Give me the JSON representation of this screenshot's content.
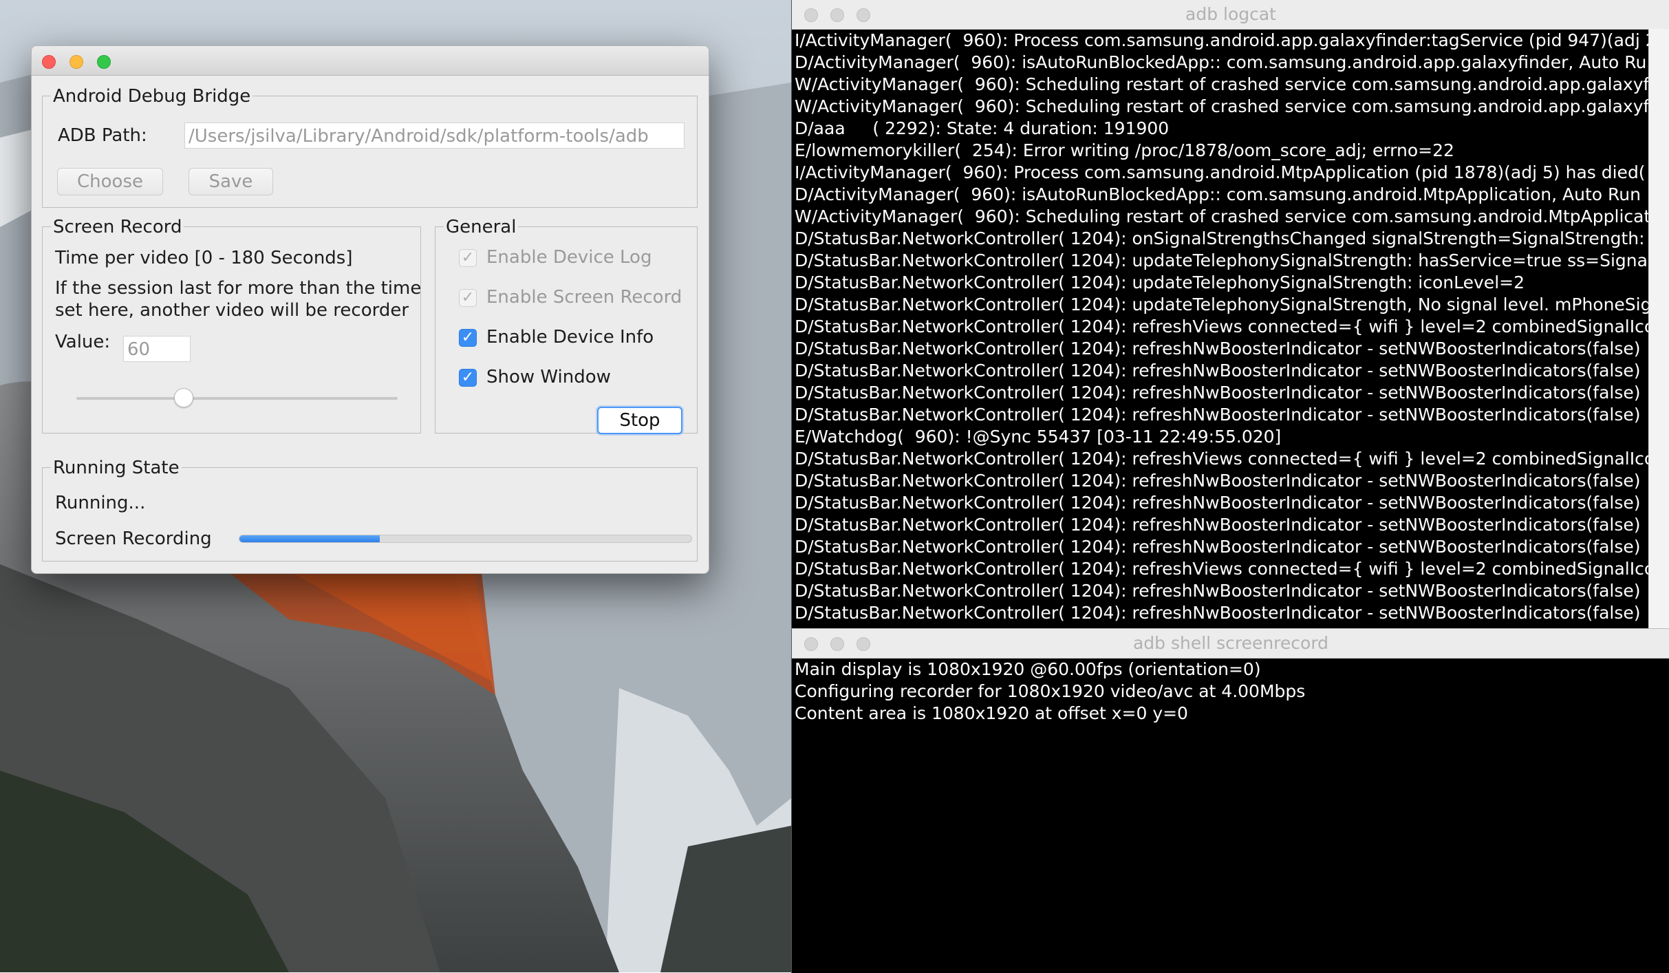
{
  "main_window": {
    "adb_group": {
      "legend": "Android Debug Bridge",
      "path_label": "ADB Path:",
      "path_value": "/Users/jsilva/Library/Android/sdk/platform-tools/adb",
      "choose_label": "Choose",
      "save_label": "Save"
    },
    "screen_record": {
      "legend": "Screen Record",
      "time_label": "Time per video [0 - 180 Seconds]",
      "desc_line1": "If the session last for more than the time",
      "desc_line2": "set here, another video will be recorder",
      "value_label": "Value:",
      "value": "60",
      "slider_min": 0,
      "slider_max": 180,
      "slider_value": 60
    },
    "general": {
      "legend": "General",
      "options": [
        {
          "label": "Enable Device Log",
          "checked": true,
          "enabled": false
        },
        {
          "label": "Enable Screen Record",
          "checked": true,
          "enabled": false
        },
        {
          "label": "Enable Device Info",
          "checked": true,
          "enabled": true
        },
        {
          "label": "Show Window",
          "checked": true,
          "enabled": true
        }
      ],
      "stop_label": "Stop"
    },
    "running_state": {
      "legend": "Running State",
      "status": "Running...",
      "task_label": "Screen Recording",
      "progress": 0.31
    }
  },
  "logcat_window": {
    "title": "adb logcat",
    "lines": [
      "I/ActivityManager(  960): Process com.samsung.android.app.galaxyfinder:tagService (pid 947)(adj 2",
      "D/ActivityManager(  960): isAutoRunBlockedApp:: com.samsung.android.app.galaxyfinder, Auto Ru",
      "W/ActivityManager(  960): Scheduling restart of crashed service com.samsung.android.app.galaxyf",
      "W/ActivityManager(  960): Scheduling restart of crashed service com.samsung.android.app.galaxyf",
      "D/aaa     ( 2292): State: 4 duration: 191900",
      "E/lowmemorykiller(  254): Error writing /proc/1878/oom_score_adj; errno=22",
      "I/ActivityManager(  960): Process com.samsung.android.MtpApplication (pid 1878)(adj 5) has died(",
      "D/ActivityManager(  960): isAutoRunBlockedApp:: com.samsung.android.MtpApplication, Auto Run",
      "W/ActivityManager(  960): Scheduling restart of crashed service com.samsung.android.MtpApplicat",
      "D/StatusBar.NetworkController( 1204): onSignalStrengthsChanged signalStrength=SignalStrength:",
      "D/StatusBar.NetworkController( 1204): updateTelephonySignalStrength: hasService=true ss=Signal",
      "D/StatusBar.NetworkController( 1204): updateTelephonySignalStrength: iconLevel=2",
      "D/StatusBar.NetworkController( 1204): updateTelephonySignalStrength, No signal level. mPhoneSig",
      "D/StatusBar.NetworkController( 1204): refreshViews connected={ wifi } level=2 combinedSignalIco",
      "D/StatusBar.NetworkController( 1204): refreshNwBoosterIndicator - setNWBoosterIndicators(false)",
      "D/StatusBar.NetworkController( 1204): refreshNwBoosterIndicator - setNWBoosterIndicators(false)",
      "D/StatusBar.NetworkController( 1204): refreshNwBoosterIndicator - setNWBoosterIndicators(false)",
      "D/StatusBar.NetworkController( 1204): refreshNwBoosterIndicator - setNWBoosterIndicators(false)",
      "E/Watchdog(  960): !@Sync 55437 [03-11 22:49:55.020]",
      "D/StatusBar.NetworkController( 1204): refreshViews connected={ wifi } level=2 combinedSignalIco",
      "D/StatusBar.NetworkController( 1204): refreshNwBoosterIndicator - setNWBoosterIndicators(false)",
      "D/StatusBar.NetworkController( 1204): refreshNwBoosterIndicator - setNWBoosterIndicators(false)",
      "D/StatusBar.NetworkController( 1204): refreshNwBoosterIndicator - setNWBoosterIndicators(false)",
      "D/StatusBar.NetworkController( 1204): refreshNwBoosterIndicator - setNWBoosterIndicators(false)",
      "D/StatusBar.NetworkController( 1204): refreshViews connected={ wifi } level=2 combinedSignalIco",
      "D/StatusBar.NetworkController( 1204): refreshNwBoosterIndicator - setNWBoosterIndicators(false)",
      "D/StatusBar.NetworkController( 1204): refreshNwBoosterIndicator - setNWBoosterIndicators(false)"
    ]
  },
  "screenrecord_window": {
    "title": "adb shell screenrecord",
    "lines": [
      "Main display is 1080x1920 @60.00fps (orientation=0)",
      "Configuring recorder for 1080x1920 video/avc at 4.00Mbps",
      "Content area is 1080x1920 at offset x=0 y=0"
    ]
  },
  "colors": {
    "accent_blue": "#3b8ef4",
    "terminal_bg": "#000000",
    "terminal_fg": "#ffffff",
    "window_bg": "#ececec"
  }
}
